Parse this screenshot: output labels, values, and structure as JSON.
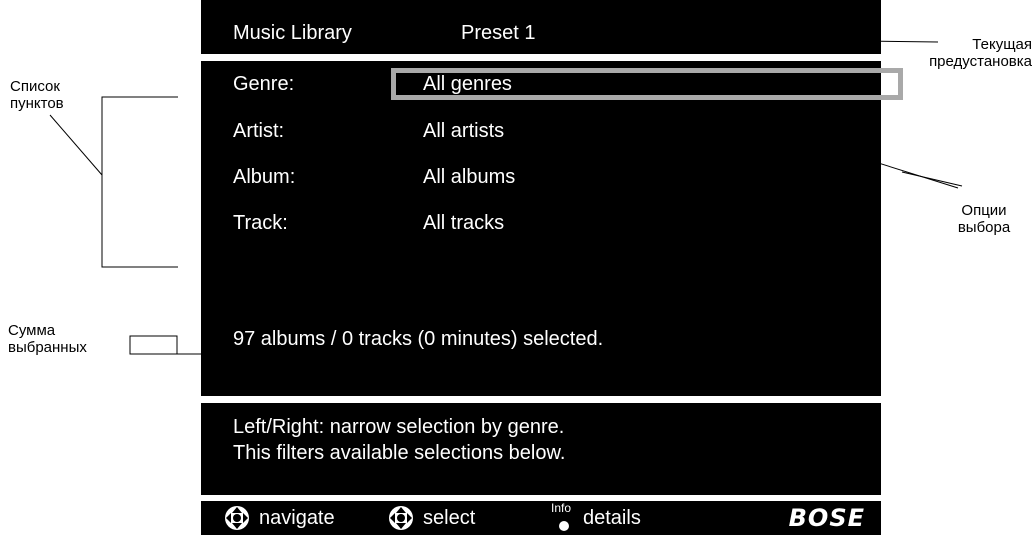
{
  "header": {
    "library_label": "Music Library",
    "preset_label": "Preset 1"
  },
  "rows": [
    {
      "label": "Genre:",
      "value": "All genres"
    },
    {
      "label": "Artist:",
      "value": "All artists"
    },
    {
      "label": "Album:",
      "value": "All albums"
    },
    {
      "label": "Track:",
      "value": "All tracks"
    }
  ],
  "summary": "97 albums / 0 tracks (0 minutes) selected.",
  "help": {
    "line1": "Left/Right: narrow selection by genre.",
    "line2": "This filters available selections below."
  },
  "footer": {
    "navigate_label": "navigate",
    "select_label": "select",
    "info_label": "Info",
    "details_label": "details",
    "brand": "BOSE"
  },
  "annotations": {
    "item_list_line1": "Список",
    "item_list_line2": "пунктов",
    "current_preset_line1": "Текущая",
    "current_preset_line2": "предустановка",
    "selection_options_line1": "Опции",
    "selection_options_line2": "выбора",
    "selection_total_line1": "Сумма",
    "selection_total_line2": "выбранных"
  },
  "colors": {
    "screen_bg": "#000000",
    "screen_text": "#ffffff",
    "highlight_border": "#a9a9a9"
  },
  "icons": {
    "navigate": "dpad-icon",
    "select": "dpad-icon",
    "details": "info-button-icon"
  }
}
